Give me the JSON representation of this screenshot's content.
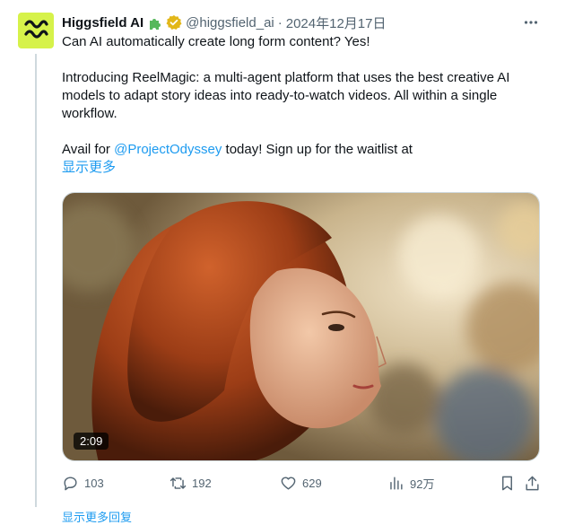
{
  "tweet": {
    "author_name": "Higgsfield AI",
    "handle": "@higgsfield_ai",
    "separator": "·",
    "date": "2024年12月17日",
    "para1": "Can AI automatically create long form content? Yes!",
    "para2": "Introducing ReelMagic: a multi-agent platform that uses the best creative AI models to adapt story ideas into ready-to-watch videos. All within a single workflow.",
    "para3_prefix": "Avail for ",
    "para3_mention": "@ProjectOdyssey",
    "para3_suffix": " today! Sign up for the waitlist at",
    "show_more": "显示更多",
    "video_duration": "2:09"
  },
  "actions": {
    "replies": "103",
    "reposts": "192",
    "likes": "629",
    "views": "92万"
  },
  "footer": {
    "show_more_replies": "显示更多回复"
  },
  "icons": {
    "name_badge_1": "puzzle-piece-icon",
    "name_badge_2": "verified-badge-icon",
    "more": "more-horizontal-icon",
    "reply": "reply-icon",
    "repost": "repost-icon",
    "like": "heart-icon",
    "views": "views-bar-icon",
    "bookmark": "bookmark-icon",
    "share": "share-icon"
  },
  "colors": {
    "link": "#1d9bf0",
    "secondary_text": "#536471",
    "avatar_bg": "#d6f24a",
    "verified_gold": "#e2b719"
  }
}
